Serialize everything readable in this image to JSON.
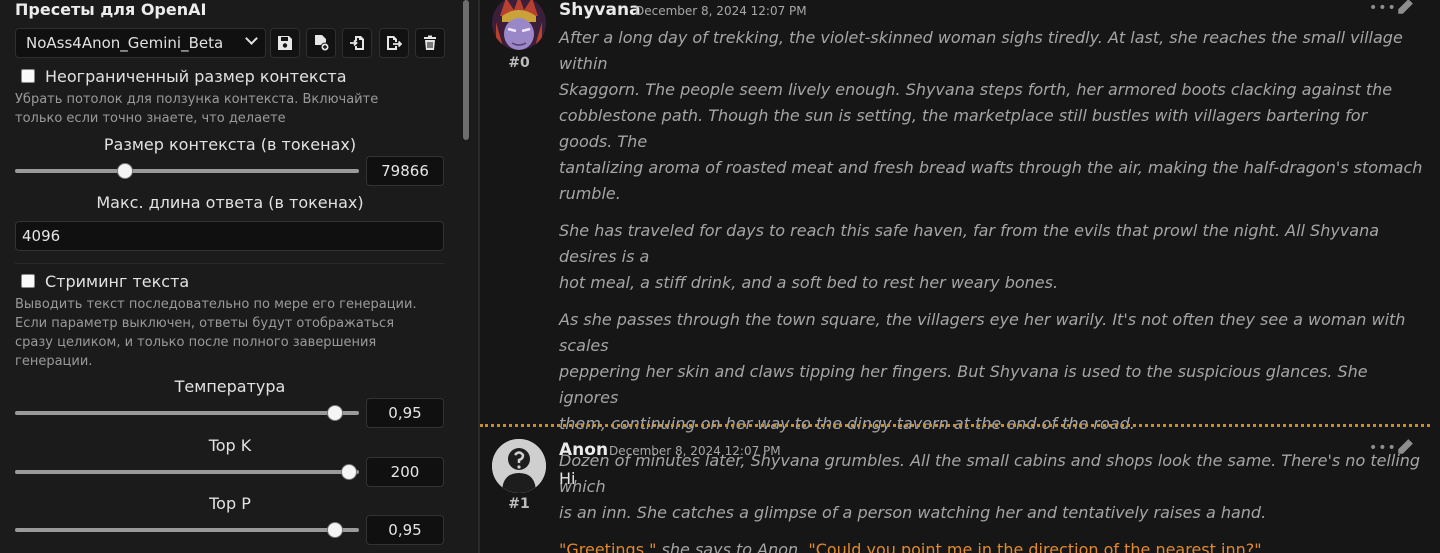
{
  "presets": {
    "title": "Пресеты для OpenAI",
    "selected_preset": "NoAss4Anon_Gemini_Beta",
    "icons": [
      "save-icon",
      "file-add-icon",
      "import-icon",
      "export-icon",
      "trash-icon"
    ]
  },
  "unlimited_context": {
    "label": "Неограниченный размер контекста",
    "hint_line1": "Убрать потолок для ползунка контекста. Включайте",
    "hint_line2": "только если точно знаете, что делаете",
    "checked": false
  },
  "context_size": {
    "label": "Размер контекста (в токенах)",
    "value": "79866",
    "fraction": 0.32
  },
  "max_response": {
    "label": "Макс. длина ответа (в токенах)",
    "value": "4096"
  },
  "streaming": {
    "label": "Стриминг текста",
    "hint_line1": "Выводить текст последовательно по мере его генерации.",
    "hint_line2": "Если параметр выключен, ответы будут отображаться",
    "hint_line3": "сразу целиком, и только после полного завершения",
    "hint_line4": "генерации.",
    "checked": false
  },
  "temperature": {
    "label": "Температура",
    "value": "0,95",
    "fraction": 0.93
  },
  "top_k": {
    "label": "Top K",
    "value": "200",
    "fraction": 0.97
  },
  "top_p": {
    "label": "Top P",
    "value": "0,95",
    "fraction": 0.93
  },
  "messages": [
    {
      "name": "Shyvana",
      "date": "December 8, 2024 12:07 PM",
      "number": "#0",
      "actions": "•••",
      "paragraphs": [
        [
          "After a long day of trekking, the violet-skinned woman sighs tiredly. At last, she reaches the small village within",
          "Skaggorn. The people seem lively enough. Shyvana steps forth, her armored boots clacking against the",
          "cobblestone path. Though the sun is setting, the marketplace still bustles with villagers bartering for goods. The",
          "tantalizing aroma of roasted meat and fresh bread wafts through the air, making the half-dragon's stomach",
          "rumble."
        ],
        [
          "She has traveled for days to reach this safe haven, far from the evils that prowl the night. All Shyvana desires is a",
          "hot meal, a stiff drink, and a soft bed to rest her weary bones."
        ],
        [
          "As she passes through the town square, the villagers eye her warily. It's not often they see a woman with scales",
          "peppering her skin and claws tipping her fingers. But Shyvana is used to the suspicious glances. She ignores",
          "them, continuing on her way to the dingy tavern at the end of the road."
        ],
        [
          "Dozen of minutes later, Shyvana grumbles. All the small cabins and shops look the same. There's no telling which",
          "is an inn. She catches a glimpse of a person watching her and tentatively raises a hand."
        ]
      ],
      "dialogue": {
        "quote1": "\"Greetings,\"",
        "narration": " she says to Anon, ",
        "quote2": "\"Could you point me in the direction of the nearest inn?\""
      }
    },
    {
      "name": "Anon",
      "date": "December 8, 2024 12:07 PM",
      "number": "#1",
      "actions": "•••",
      "text": "Hi"
    }
  ]
}
